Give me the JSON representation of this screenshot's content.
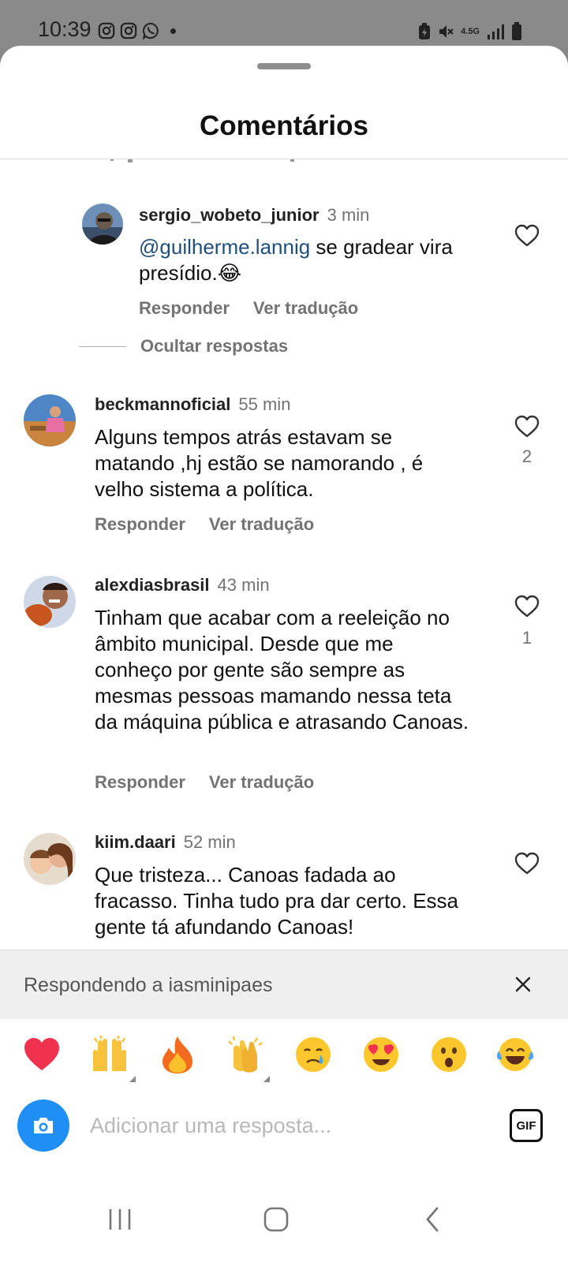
{
  "status_bar": {
    "time": "10:39",
    "network": "4.5G"
  },
  "sheet": {
    "title": "Comentários"
  },
  "comments": [
    {
      "username": "sergio_wobeto_junior",
      "time": "3 min",
      "mention": "@guilherme.lannig",
      "text": " se gradear vira presídio.😂",
      "reply_label": "Responder",
      "translate_label": "Ver tradução",
      "likes": ""
    },
    {
      "username": "beckmannoficial",
      "time": "55 min",
      "text": "Alguns tempos atrás estavam se matando ,hj estão se  namorando , é velho sistema a política.",
      "reply_label": "Responder",
      "translate_label": "Ver tradução",
      "likes": "2"
    },
    {
      "username": "alexdiasbrasil",
      "time": "43 min",
      "text": "Tinham que acabar com a reeleição no âmbito municipal. Desde que me conheço por gente são sempre as mesmas pessoas mamando nessa teta da máquina pública e atrasando Canoas.",
      "reply_label": "Responder",
      "translate_label": "Ver tradução",
      "likes": "1"
    },
    {
      "username": "kiim.daari",
      "time": "52 min",
      "text": "Que tristeza... Canoas fadada ao fracasso. Tinha tudo pra dar certo. Essa gente tá afundando Canoas!",
      "likes": ""
    }
  ],
  "hide_replies_label": "Ocultar respostas",
  "reply_banner": {
    "text": "Respondendo a iasminipaes"
  },
  "emoji_bar": [
    "heart",
    "raising-hands",
    "fire",
    "clapping-hands",
    "crying-face",
    "heart-eyes",
    "surprised-face",
    "tears-of-joy"
  ],
  "input": {
    "placeholder": "Adicionar uma resposta...",
    "value": "",
    "gif_label": "GIF"
  },
  "colors": {
    "accent": "#1f8ff5",
    "mention": "#1f4f7d",
    "secondary_text": "#737373",
    "banner_bg": "#efefef"
  }
}
